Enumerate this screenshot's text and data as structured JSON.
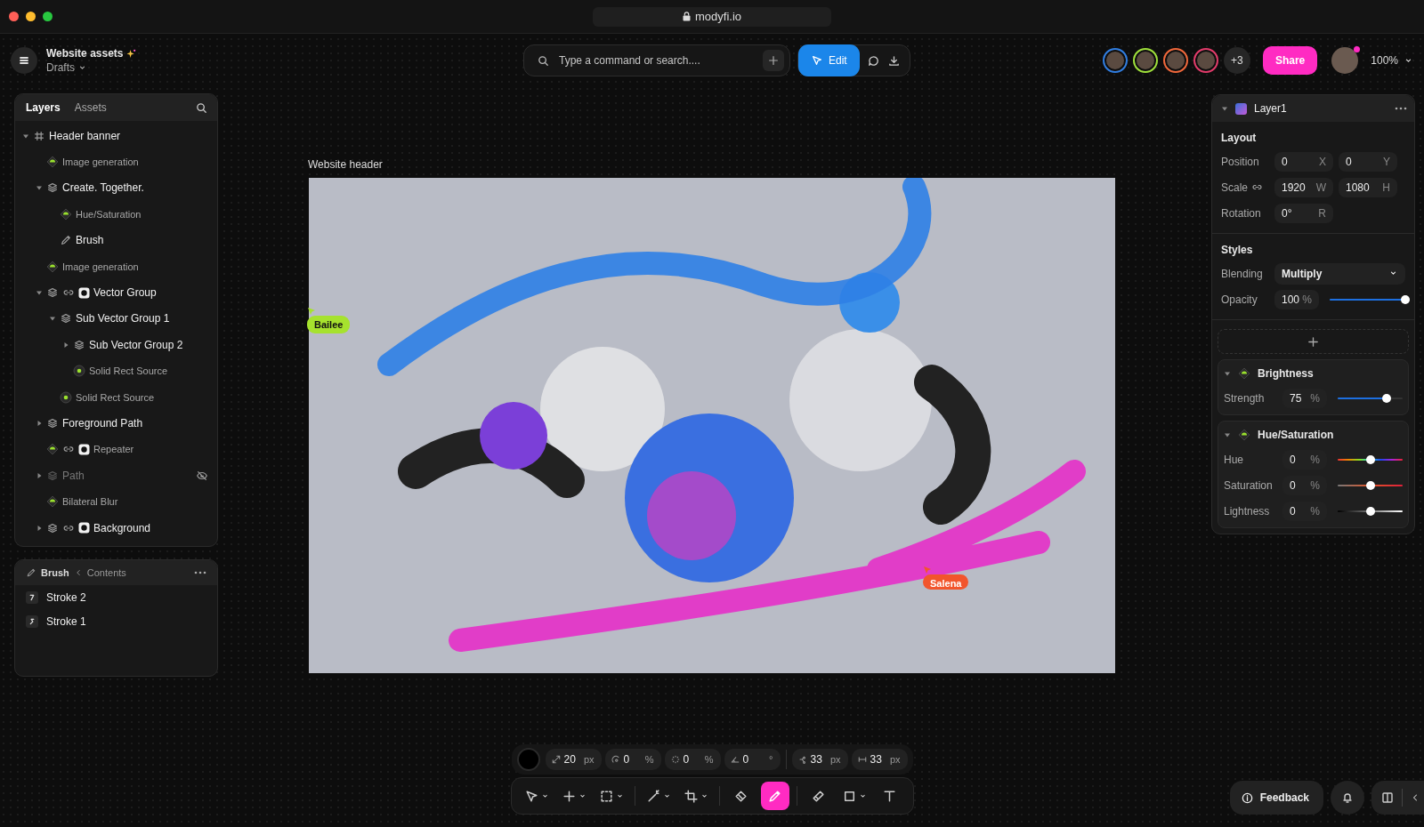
{
  "window": {
    "url": "modyfi.io"
  },
  "header": {
    "title": "Website assets",
    "subtitle": "Drafts"
  },
  "command_bar": {
    "placeholder": "Type a command or search....",
    "edit_label": "Edit"
  },
  "collaborators": [
    {
      "color": "#2f7de1"
    },
    {
      "color": "#9ee03a"
    },
    {
      "color": "#f0673a"
    },
    {
      "color": "#e23a6a"
    }
  ],
  "more_collaborators": "+3",
  "share_label": "Share",
  "zoom": "100%",
  "layers_panel": {
    "tabs": [
      {
        "label": "Layers",
        "selected": true
      },
      {
        "label": "Assets",
        "selected": false
      }
    ],
    "tree": [
      {
        "label": "Header banner",
        "kind": "frame",
        "expanded": true,
        "children": [
          {
            "label": "Image generation",
            "kind": "effect"
          },
          {
            "label": "Create. Together.",
            "kind": "group",
            "expanded": true,
            "children": [
              {
                "label": "Hue/Saturation",
                "kind": "effect"
              },
              {
                "label": "Brush",
                "kind": "brush"
              }
            ]
          },
          {
            "label": "Image generation",
            "kind": "effect"
          },
          {
            "label": "Vector Group",
            "kind": "group",
            "linked": true,
            "masked": true,
            "expanded": true,
            "children": [
              {
                "label": "Sub Vector Group 1",
                "kind": "group",
                "expanded": true,
                "children": [
                  {
                    "label": "Sub Vector Group 2",
                    "kind": "group",
                    "expanded": false
                  },
                  {
                    "label": "Solid Rect Source",
                    "kind": "source"
                  }
                ]
              },
              {
                "label": "Solid Rect Source",
                "kind": "source"
              }
            ]
          },
          {
            "label": "Foreground Path",
            "kind": "group",
            "expanded": false
          },
          {
            "label": "Repeater",
            "kind": "effect",
            "linked": true,
            "masked": true
          },
          {
            "label": "Path",
            "kind": "group",
            "expanded": false,
            "hidden": true
          },
          {
            "label": "Bilateral Blur",
            "kind": "effect"
          },
          {
            "label": "Background",
            "kind": "group",
            "linked": true,
            "masked": true,
            "expanded": false
          }
        ]
      }
    ]
  },
  "brush_panel": {
    "breadcrumb": [
      "Brush",
      "Contents"
    ],
    "items": [
      {
        "label": "Stroke 2"
      },
      {
        "label": "Stroke 1"
      }
    ]
  },
  "canvas": {
    "artboard_label": "Website header",
    "cursors": [
      {
        "name": "Bailee",
        "color": "#a6e22e"
      },
      {
        "name": "Salena",
        "color": "#f2552c"
      }
    ]
  },
  "inspector": {
    "layer": "Layer1",
    "layout": {
      "title": "Layout",
      "rows": [
        {
          "label": "Position",
          "linked": false,
          "fields": [
            {
              "value": "0",
              "unit": "X"
            },
            {
              "value": "0",
              "unit": "Y"
            }
          ]
        },
        {
          "label": "Scale",
          "linked": true,
          "fields": [
            {
              "value": "1920",
              "unit": "W"
            },
            {
              "value": "1080",
              "unit": "H"
            }
          ]
        },
        {
          "label": "Rotation",
          "linked": false,
          "fields": [
            {
              "value": "0°",
              "unit": "R"
            }
          ]
        }
      ]
    },
    "styles": {
      "title": "Styles",
      "blending": {
        "label": "Blending",
        "value": "Multiply"
      },
      "opacity": {
        "label": "Opacity",
        "value": "100",
        "unit": "%",
        "level": 1
      }
    },
    "effects": [
      {
        "name": "Brightness",
        "expanded": true,
        "params": [
          {
            "label": "Strength",
            "value": "75",
            "unit": "%",
            "level": 0.75
          }
        ]
      },
      {
        "name": "Hue/Saturation",
        "expanded": true,
        "params": [
          {
            "label": "Hue",
            "value": "0",
            "unit": "%",
            "level": 0.5,
            "kind": "hue"
          },
          {
            "label": "Saturation",
            "value": "0",
            "unit": "%",
            "level": 0.5,
            "kind": "saturation"
          },
          {
            "label": "Lightness",
            "value": "0",
            "unit": "%",
            "level": 0.5,
            "kind": "lightness"
          }
        ]
      }
    ]
  },
  "stroke_bar": {
    "color": "#000000",
    "field_groups": [
      [
        {
          "kind": "size",
          "value": "20",
          "unit": "px"
        },
        {
          "kind": "flow",
          "value": "0",
          "unit": "%"
        },
        {
          "kind": "spacing",
          "value": "0",
          "unit": "%"
        },
        {
          "kind": "angle",
          "value": "0",
          "unit": "°"
        }
      ],
      [
        {
          "kind": "smoothing",
          "value": "33",
          "unit": "px"
        },
        {
          "kind": "width",
          "value": "33",
          "unit": "px"
        }
      ]
    ]
  },
  "tool_groups": [
    [
      {
        "kind": "select",
        "dropdown": true,
        "selected": false
      },
      {
        "kind": "add",
        "dropdown": true,
        "selected": false
      },
      {
        "kind": "marquee",
        "dropdown": true,
        "selected": false
      }
    ],
    [
      {
        "kind": "wand",
        "dropdown": true,
        "selected": false
      },
      {
        "kind": "crop",
        "dropdown": true,
        "selected": false
      }
    ],
    [
      {
        "kind": "fill",
        "dropdown": false,
        "selected": false
      },
      {
        "kind": "brush",
        "dropdown": false,
        "selected": true
      }
    ],
    [
      {
        "kind": "eraser",
        "dropdown": false,
        "selected": false
      },
      {
        "kind": "shape",
        "dropdown": true,
        "selected": false
      },
      {
        "kind": "text",
        "dropdown": false,
        "selected": false
      }
    ]
  ],
  "footer": {
    "feedback_label": "Feedback"
  }
}
